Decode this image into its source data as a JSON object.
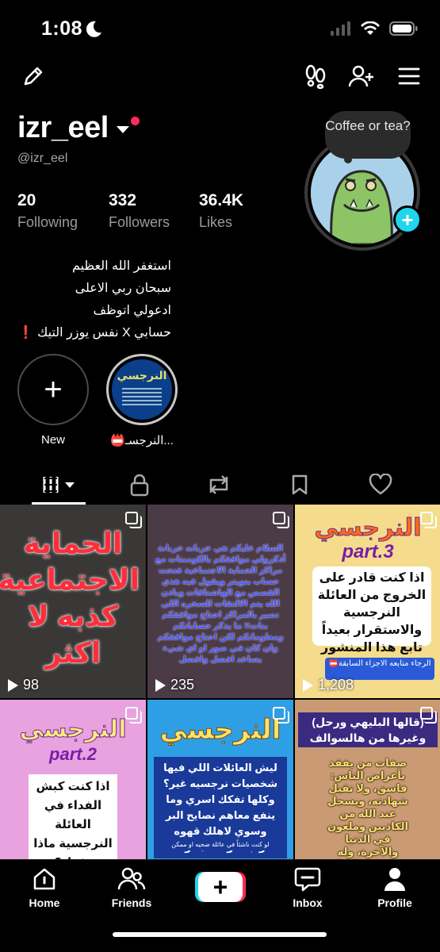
{
  "status_bar": {
    "time": "1:08",
    "icons": [
      "moon-icon",
      "signal-icon",
      "wifi-icon",
      "battery-icon"
    ]
  },
  "top_bar": {
    "icons": [
      "pencil-icon",
      "footprints-icon",
      "add-user-icon",
      "menu-icon"
    ]
  },
  "profile": {
    "username": "izr_eel",
    "handle": "@izr_eel",
    "note": "Coffee or tea?",
    "stats": [
      {
        "value": "20",
        "label": "Following"
      },
      {
        "value": "332",
        "label": "Followers"
      },
      {
        "value": "36.4K",
        "label": "Likes"
      }
    ],
    "bio_lines": [
      "استغفر الله العظيم",
      "سبحان ربي الاعلى",
      "ادعولي اتوظف",
      "حسابي X نفس يوزر التيك ❗"
    ]
  },
  "highlights": [
    {
      "label": "New"
    },
    {
      "label": "📛النرجسـ...",
      "cover_title": "النرجسي"
    }
  ],
  "tabs": [
    "grid-icon",
    "lock-icon",
    "repost-icon",
    "bookmark-icon",
    "heart-icon"
  ],
  "videos": [
    {
      "views": "98",
      "text": "الحماية الاجتماعية كذبه لا اكثر"
    },
    {
      "views": "235",
      "text": "السلام عليكم هي خربانه خربانة أذكرولي مواقفكم بالكومنتات مع مراكز الحماية الاجتماعية فتحت حساب بتويتر ويقول فيه هذي القصص مع الهاشتاقات وباذن الله يتم الالتفات للسخره اللي تصير بالمراكز احتاج مواقفكم بنات!! ما يذكر حساباتكم ومعلوماتكم لكن احتاج مواقفكم وان كان في صور او اي شيء يساعد افضل وافضل"
    },
    {
      "views": "1,208",
      "title": "النرجسي",
      "part": "part.3",
      "text": "اذا كنت قادر على الخروج من العائلة النرجسية والاستقرار بعيداً تابع هذا المنشور",
      "note": "الرجاء متابعه الاجزاء السابقة📛"
    },
    {
      "title": "النرجسي",
      "part": "part.2",
      "text": "اذا كنت كبش الفداء في العائلة النرجسية ماذا تفعل؟"
    },
    {
      "title": "النرجسي",
      "text": "ليش العائلات اللي فيها شخصيات نرجسيه غير؟ وكلها تفكك اسري وما ينفع معاهم نصايح البر وسوي لاهلك قهوه واجلسوا تفاهموا؟",
      "note": "لو كنت ناشئاً في عائلة صحيه او ممكن"
    },
    {
      "title": "(قالها البليهي ورحل) وغيرها من هالسوالف",
      "text": "صفات من يفقد بأعراض الناس: فاسق، ولا تقبل شهادته، ويسجل عند الله من الكاذبين وملعون في الدنيا والآخرة، وله عذاب يوم القيامة وتشهد عليه جوارحه"
    }
  ],
  "bottom_nav": {
    "items": [
      {
        "label": "Home",
        "icon": "home-icon"
      },
      {
        "label": "Friends",
        "icon": "friends-icon"
      },
      {
        "label": "",
        "icon": "create-icon"
      },
      {
        "label": "Inbox",
        "icon": "inbox-icon"
      },
      {
        "label": "Profile",
        "icon": "profile-icon"
      }
    ]
  },
  "colors": {
    "accent_cyan": "#20d5ec",
    "accent_red": "#fe2c55",
    "background": "#000000"
  }
}
